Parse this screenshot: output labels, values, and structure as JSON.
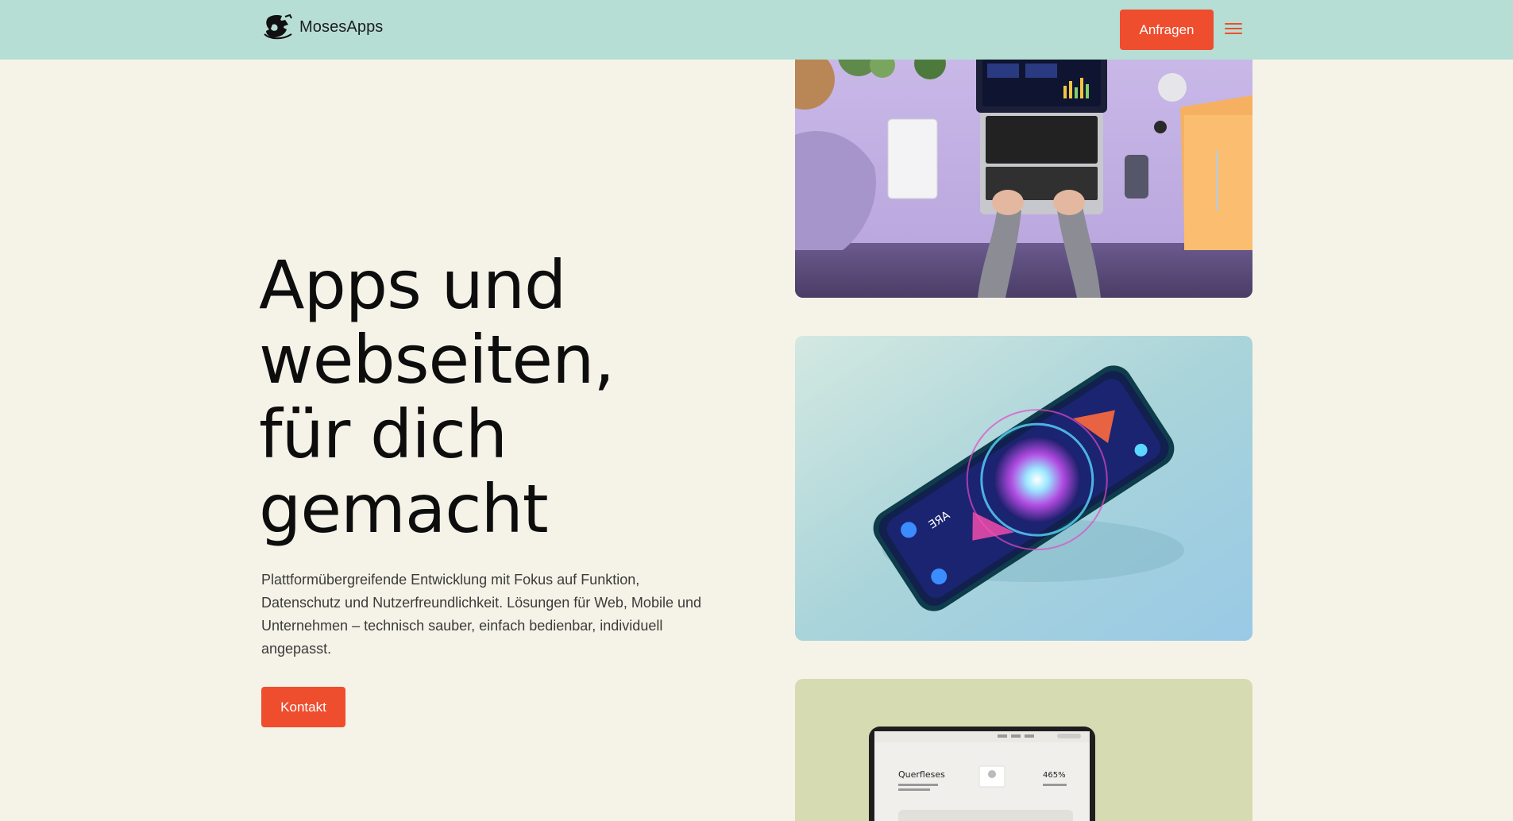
{
  "header": {
    "brand_name": "MosesApps",
    "cta_label": "Anfragen",
    "logo_icon": "mosesapps-logo",
    "menu_icon": "hamburger-menu-icon"
  },
  "hero": {
    "title_lines": [
      "Apps und",
      "webseiten,",
      "für dich",
      "gemacht"
    ],
    "description": "Plattformübergreifende Entwicklung mit Fokus auf Funktion, Datenschutz und Nutzerfreundlichkeit. Lösungen für Web, Mobile und Unternehmen – technisch sauber, einfach bedienbar, individuell angepasst.",
    "cta_label": "Kontakt"
  },
  "images": {
    "laptop_screen_title": "Querfleses",
    "laptop_screen_stat": "465%",
    "phone_screen_text": "ƎЯA"
  },
  "colors": {
    "header_bg": "#b6ded4",
    "page_bg": "#f5f3e7",
    "accent": "#ee4d2e"
  }
}
